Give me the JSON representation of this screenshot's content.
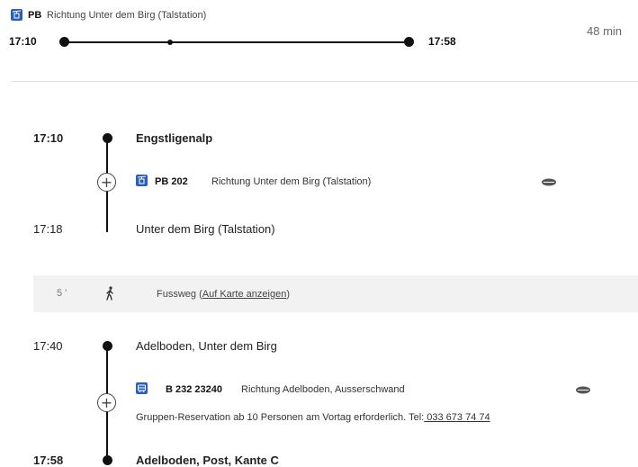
{
  "summary": {
    "mode_icon": "cable-car-icon",
    "line_code": "PB",
    "direction": "Richtung Unter dem Birg (Talstation)",
    "departure_time": "17:10",
    "arrival_time": "17:58",
    "duration": "48 min"
  },
  "legs": [
    {
      "type": "ride",
      "from_time": "17:10",
      "from_stop": "Engstligenalp",
      "mode_icon": "cable-car-icon",
      "line_code": "PB 202",
      "direction": "Richtung Unter dem Birg (Talstation)",
      "occupancy_icon": "occupancy-icon",
      "to_time": "17:18",
      "to_stop": "Unter dem Birg (Talstation)"
    },
    {
      "type": "walk",
      "minutes": "5 '",
      "icon": "walking-person-icon",
      "label_prefix": "Fussweg (",
      "map_link": "Auf Karte anzeigen",
      "label_suffix": ")"
    },
    {
      "type": "ride",
      "from_time": "17:40",
      "from_stop": "Adelboden, Unter dem Birg",
      "mode_icon": "bus-icon",
      "line_code": "B 232 23240",
      "direction": "Richtung Adelboden, Ausserschwand",
      "occupancy_icon": "occupancy-icon",
      "note_text": "Gruppen-Reservation ab 10 Personen am Vortag erforderlich. Tel:",
      "note_phone": " 033 673 74 74",
      "to_time": "17:58",
      "to_stop": "Adelboden, Post, Kante C"
    }
  ],
  "colors": {
    "accent": "#2b5fb3",
    "walk_band": "#f2f2f2",
    "timeline": "#111111"
  }
}
